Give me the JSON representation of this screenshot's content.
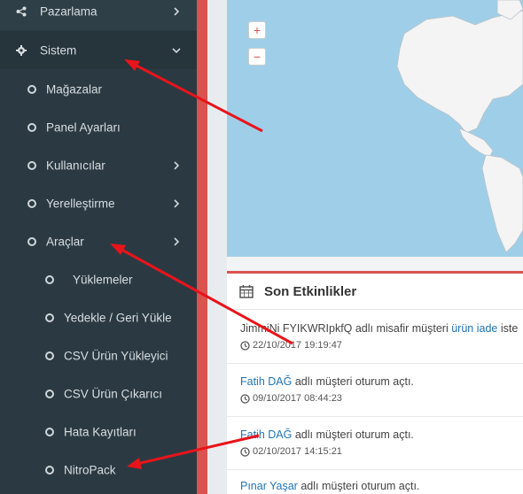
{
  "sidebar": {
    "items": [
      {
        "label": "Pazarlama",
        "icon": "share-icon",
        "level": 0,
        "chevron": "right"
      },
      {
        "label": "Sistem",
        "icon": "gear-icon",
        "level": 0,
        "chevron": "down"
      },
      {
        "label": "Mağazalar",
        "icon": "circle-icon",
        "level": 1
      },
      {
        "label": "Panel Ayarları",
        "icon": "circle-icon",
        "level": 1
      },
      {
        "label": "Kullanıcılar",
        "icon": "circle-icon",
        "level": 1,
        "chevron": "right"
      },
      {
        "label": "Yerelleştirme",
        "icon": "circle-icon",
        "level": 1,
        "chevron": "right"
      },
      {
        "label": "Araçlar",
        "icon": "circle-icon",
        "level": 1,
        "chevron": "right"
      },
      {
        "label": "Yüklemeler",
        "icon": "circle-icon",
        "level": 2
      },
      {
        "label": "Yedekle / Geri Yükle",
        "icon": "circle-icon",
        "level": 2
      },
      {
        "label": "CSV Ürün Yükleyici",
        "icon": "circle-icon",
        "level": 2
      },
      {
        "label": "CSV Ürün Çıkarıcı",
        "icon": "circle-icon",
        "level": 2
      },
      {
        "label": "Hata Kayıtları",
        "icon": "circle-icon",
        "level": 2
      },
      {
        "label": "NitroPack",
        "icon": "circle-icon",
        "level": 2
      }
    ]
  },
  "map": {
    "zoom_in": "+",
    "zoom_out": "−"
  },
  "activity": {
    "title": "Son Etkinlikler",
    "icon": "calendar-icon",
    "items": [
      {
        "pre": "JimmiNi FYIKWRIpkfQ adlı misafir müşteri ",
        "link": "ürün iade",
        "post": " iste",
        "time": "22/10/2017 19:19:47"
      },
      {
        "pre": "",
        "link": "Fatih DAĞ",
        "post": " adlı müşteri oturum açtı.",
        "time": "09/10/2017 08:44:23"
      },
      {
        "pre": "",
        "link": "Fatih DAĞ",
        "post": " adlı müşteri oturum açtı.",
        "time": "02/10/2017 14:15:21"
      },
      {
        "pre": "",
        "link": "Pınar Yaşar",
        "post": " adlı müşteri oturum açtı.",
        "time": ""
      }
    ]
  },
  "colors": {
    "sidebar_bg": "#2b3a42",
    "accent": "#d9534f",
    "link": "#1f73b7",
    "map_water": "#9fcfe8",
    "arrow": "#e8141b"
  }
}
